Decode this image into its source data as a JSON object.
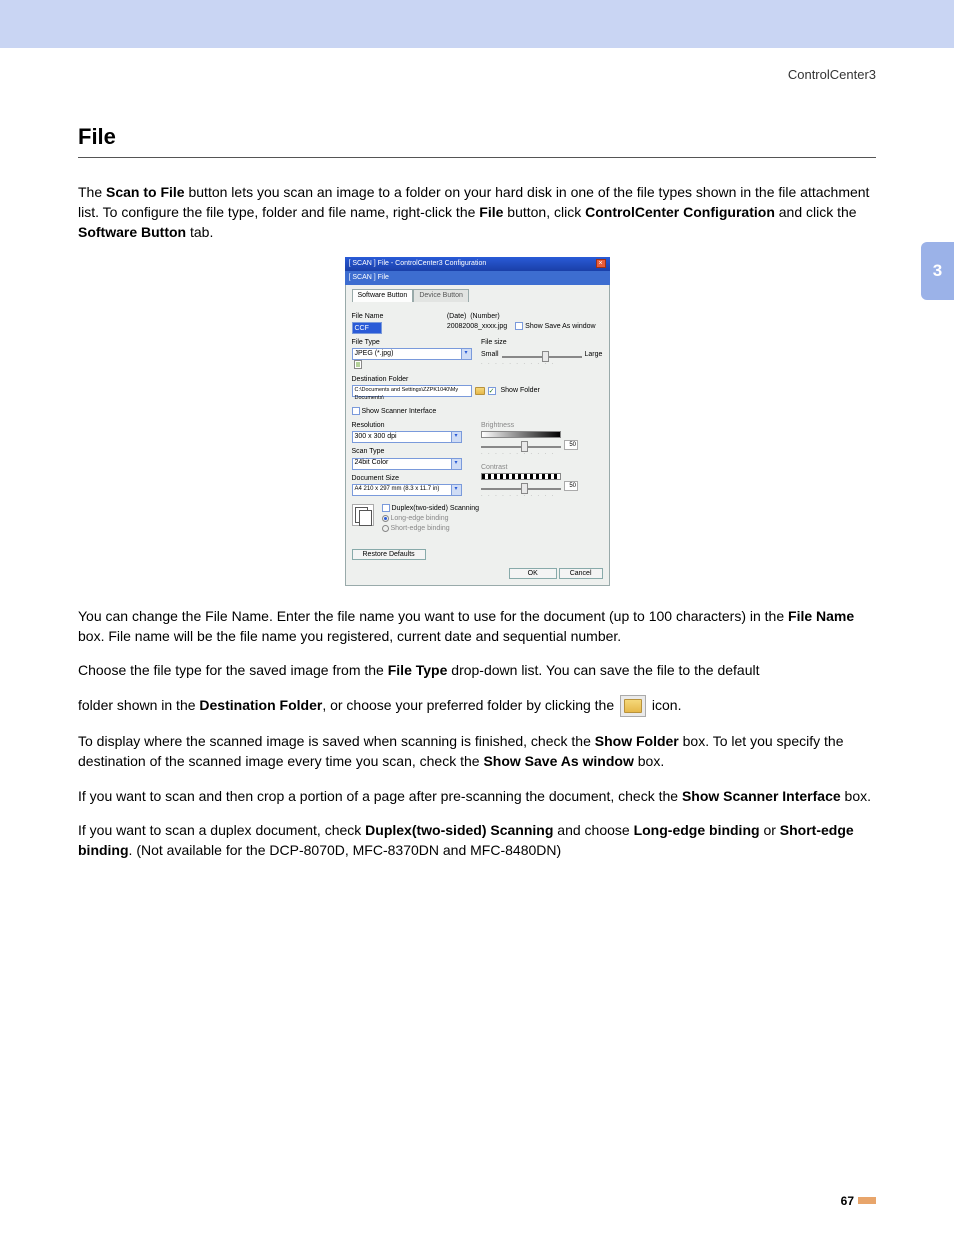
{
  "running_head": "ControlCenter3",
  "chapter_tab": "3",
  "page_number": "67",
  "heading": "File",
  "para1_a": "The ",
  "para1_b": "Scan to File",
  "para1_c": " button lets you scan an image to a folder on your hard disk in one of the file types shown in the file attachment list. To configure the file type, folder and file name, right-click the ",
  "para1_d": "File",
  "para1_e": " button, click ",
  "para1_f": "ControlCenter Configuration",
  "para1_g": " and click the ",
  "para1_h": "Software Button",
  "para1_i": " tab.",
  "para2_a": "You can change the File Name. Enter the file name you want to use for the document (up to 100 characters) in the ",
  "para2_b": "File Name",
  "para2_c": " box. File name will be the file name you registered, current date and sequential number.",
  "para3_a": "Choose the file type for the saved image from the ",
  "para3_b": "File Type",
  "para3_c": " drop-down list. You can save the file to the default",
  "para4_a": "folder shown in the ",
  "para4_b": "Destination Folder",
  "para4_c": ", or choose your preferred folder by clicking the",
  "para4_d": " icon.",
  "para5_a": "To display where the scanned image is saved when scanning is finished, check the ",
  "para5_b": "Show Folder",
  "para5_c": " box. To let you specify the destination of the scanned image every time you scan, check the ",
  "para5_d": "Show Save As window",
  "para5_e": " box.",
  "para6_a": "If you want to scan and then crop a portion of a page after pre-scanning the document, check the ",
  "para6_b": "Show Scanner Interface",
  "para6_c": " box.",
  "para7_a": "If you want to scan a duplex document, check ",
  "para7_b": "Duplex(two-sided) Scanning",
  "para7_c": " and choose ",
  "para7_d": "Long-edge binding",
  "para7_e": " or ",
  "para7_f": "Short-edge binding",
  "para7_g": ". (Not available for the DCP-8070D, MFC-8370DN and MFC-8480DN)",
  "dialog": {
    "title": "[ SCAN ]  File - ControlCenter3 Configuration",
    "subtitle": "[ SCAN ]  File",
    "tabs": {
      "active": "Software Button",
      "inactive": "Device Button"
    },
    "fields": {
      "file_name_lbl": "File Name",
      "file_name_val": "CCF",
      "date_lbl": "(Date)",
      "number_lbl": "(Number)",
      "date_sample": "20082008_xxxx.jpg",
      "show_save_as": "Show Save As window",
      "file_type_lbl": "File Type",
      "file_type_val": "JPEG (*.jpg)",
      "file_size_lbl": "File size",
      "small": "Small",
      "large": "Large",
      "dest_lbl": "Destination Folder",
      "dest_val": "C:\\Documents and Settings\\ZZPK1040\\My Documents\\",
      "show_folder": "Show Folder",
      "show_scanner": "Show Scanner Interface",
      "res_lbl": "Resolution",
      "res_val": "300 x 300 dpi",
      "brightness_lbl": "Brightness",
      "scan_type_lbl": "Scan Type",
      "scan_type_val": "24bit Color",
      "contrast_lbl": "Contrast",
      "doc_size_lbl": "Document Size",
      "doc_size_val": "A4 210 x 297 mm (8.3 x 11.7 in)",
      "duplex_chk": "Duplex(two-sided) Scanning",
      "long_edge": "Long-edge binding",
      "short_edge": "Short-edge binding",
      "fifty": "50",
      "restore": "Restore Defaults",
      "ok": "OK",
      "cancel": "Cancel"
    }
  }
}
